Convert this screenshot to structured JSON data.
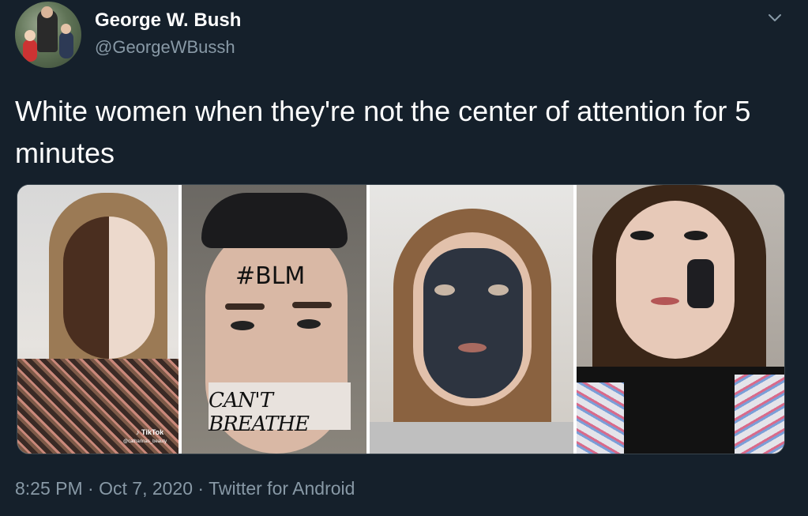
{
  "author": {
    "name": "George W. Bush",
    "handle": "@GeorgeWBussh"
  },
  "tweet": {
    "text": "White women when they're not the center of attention for 5 minutes"
  },
  "media": {
    "watermark_brand": "TikTok",
    "watermark_user": "@catharinas_beauty",
    "photo2_forehead_text": "#BLM",
    "photo2_mouth_text": "CAN'T BREATHE"
  },
  "meta": {
    "time": "8:25 PM",
    "separator1": " · ",
    "date": "Oct 7, 2020",
    "separator2": " · ",
    "source": "Twitter for Android"
  },
  "colors": {
    "background": "#15202b",
    "secondary_text": "#8899a6",
    "border": "#38444d"
  },
  "icons": {
    "more": "chevron-down-icon",
    "tiktok": "tiktok-icon"
  }
}
